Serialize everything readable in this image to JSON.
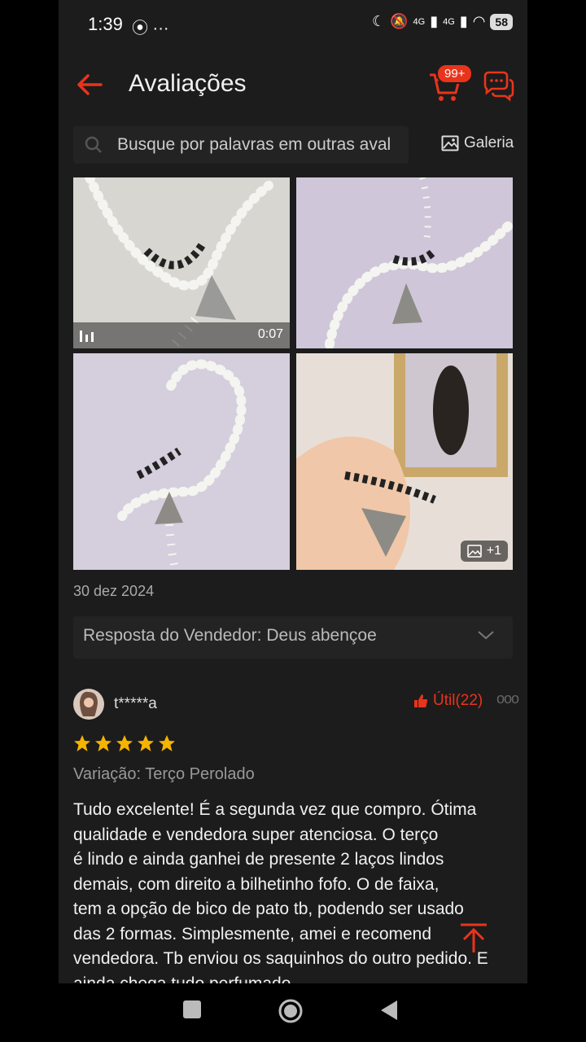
{
  "status": {
    "time": "1:39",
    "left_icons": "⦿ ···",
    "network_4g_1": "4G",
    "network_4g_2": "4G",
    "battery": "58"
  },
  "header": {
    "title": "Avaliações",
    "cart_badge": "99+"
  },
  "search": {
    "placeholder": "Busque por palavras em outras aval",
    "gallery_label": "Galeria"
  },
  "media": {
    "video_duration": "0:07",
    "more_photos": "+1"
  },
  "review_prev": {
    "date": "30 dez 2024",
    "seller_reply_label": "Resposta do Vendedor:",
    "seller_reply_text": "Deus abençoe"
  },
  "review": {
    "username": "t*****a",
    "helpful_label": "Útil(22)",
    "rating": 5,
    "variation": "Variação: Terço Perolado",
    "lines": [
      "Tudo excelente! É a segunda vez que compro. Ótima",
      "qualidade e vendedora super atenciosa. O terço",
      "é lindo e ainda ganhei de presente 2 laços lindos",
      "demais, com direito a bilhetinho fofo. O de faixa,",
      "tem a opção de bico de pato tb, podendo ser usado",
      "das 2 formas. Simplesmente, amei e recomend",
      "vendedora. Tb enviou os saquinhos do outro pedido. E",
      "ainda chega tudo perfumado."
    ]
  },
  "colors": {
    "accent": "#e8341c",
    "background": "#1c1c1c",
    "star": "#f5b400"
  }
}
